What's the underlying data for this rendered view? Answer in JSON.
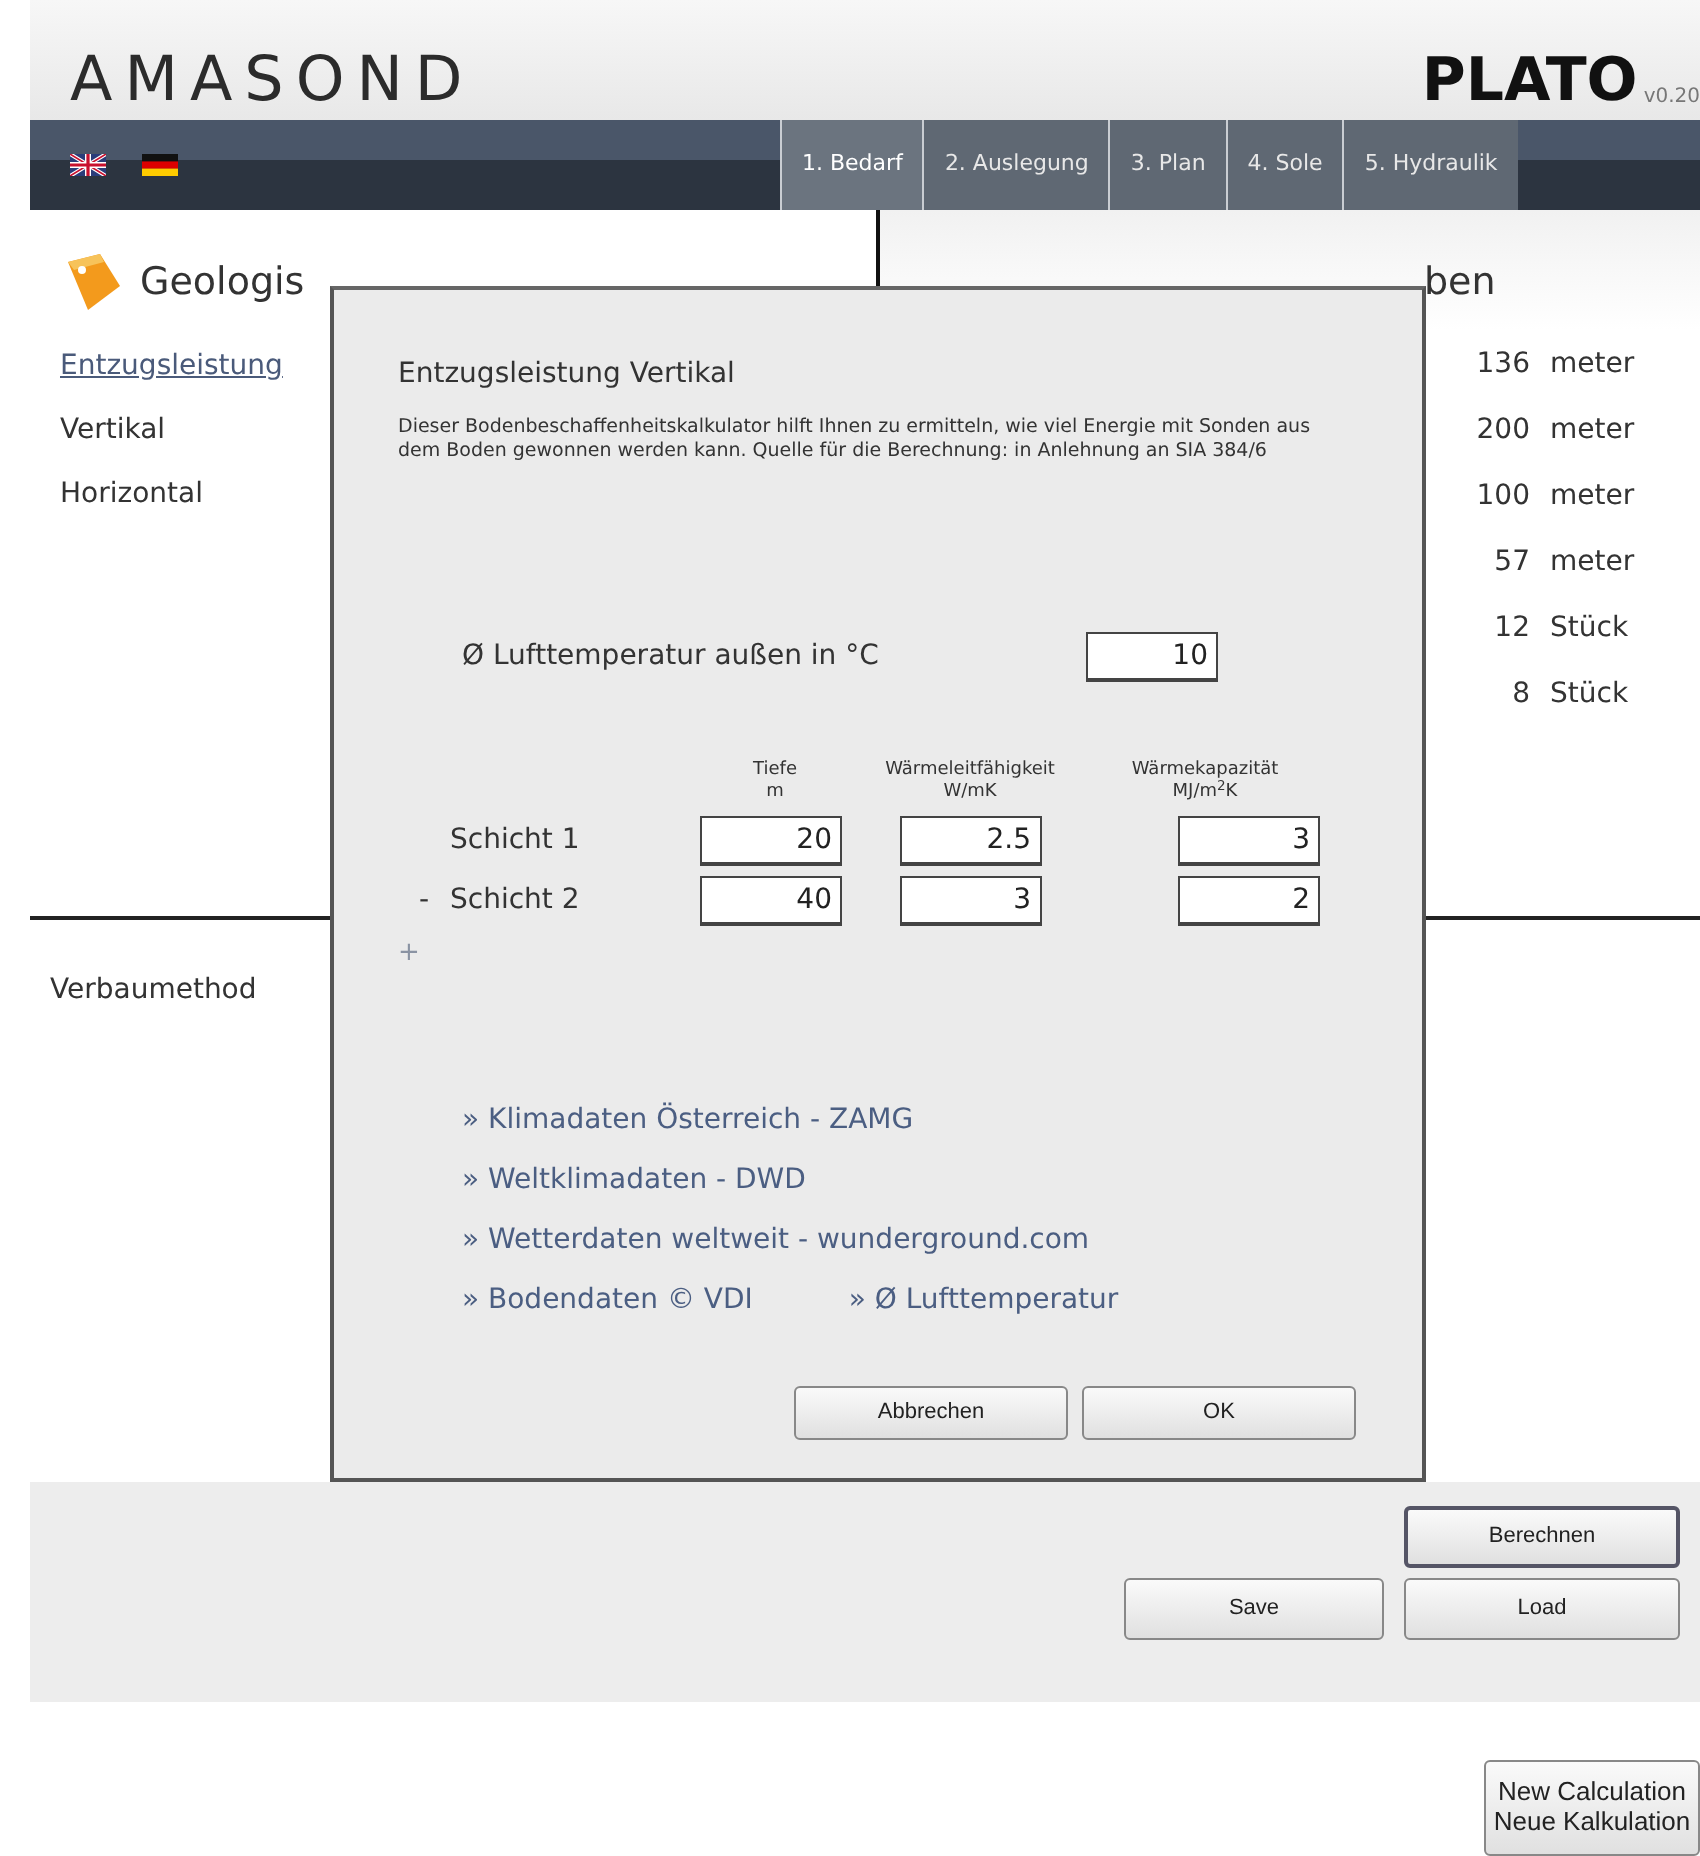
{
  "header": {
    "logo": "AMASOND",
    "product": "PLATO",
    "version": "v0.20"
  },
  "languages": [
    {
      "kind": "uk"
    },
    {
      "kind": "de"
    }
  ],
  "tabs": [
    {
      "label": "1. Bedarf",
      "selected": true
    },
    {
      "label": "2. Auslegung",
      "selected": false
    },
    {
      "label": "3. Plan",
      "selected": false
    },
    {
      "label": "4. Sole",
      "selected": false
    },
    {
      "label": "5. Hydraulik",
      "selected": false
    }
  ],
  "left_panel": {
    "title": "Geologis",
    "items": [
      {
        "label": "Entzugsleistung",
        "kind": "link"
      },
      {
        "label": "Vertikal",
        "kind": "text"
      },
      {
        "label": "Horizontal",
        "kind": "text"
      }
    ]
  },
  "right_panel": {
    "title": "ben",
    "rows": [
      {
        "value": "136",
        "unit": "meter"
      },
      {
        "value": "200",
        "unit": "meter"
      },
      {
        "value": "100",
        "unit": "meter"
      },
      {
        "value": "57",
        "unit": "meter"
      },
      {
        "value": "12",
        "unit": "Stück"
      },
      {
        "value": "8",
        "unit": "Stück"
      }
    ]
  },
  "lower_panel": {
    "title": "Verbaumethod"
  },
  "dialog": {
    "title": "Entzugsleistung Vertikal",
    "description": "Dieser Bodenbeschaffenheitskalkulator hilft Ihnen zu ermitteln, wie viel Energie mit Sonden aus dem Boden gewonnen werden kann. Quelle für die Berechnung: in Anlehnung an SIA 384/6",
    "temperature": {
      "label": "Ø Lufttemperatur außen in °C",
      "value": "10"
    },
    "columns": [
      {
        "label": "Tiefe",
        "unit": "m"
      },
      {
        "label": "Wärmeleitfähigkeit",
        "unit": "W/mK"
      },
      {
        "label": "Wärmekapazität",
        "unit": "MJ/m$^{2}$K"
      }
    ],
    "layers": [
      {
        "label": "Schicht 1",
        "values": [
          "20",
          "2.5",
          "3"
        ]
      },
      {
        "label": "Schicht 2",
        "remove": "-",
        "values": [
          "40",
          "3",
          "2"
        ]
      }
    ],
    "add": "+",
    "links": [
      [
        "» Klimadaten Österreich - ZAMG"
      ],
      [
        "» Weltklimadaten - DWD"
      ],
      [
        "» Wetterdaten weltweit - wunderground.com"
      ],
      [
        "» Bodendaten © VDI",
        "» Ø Lufttemperatur"
      ]
    ],
    "buttons": [
      "Abbrechen",
      "OK"
    ]
  },
  "actions": {
    "calculate": "Berechnen",
    "save": "Save",
    "load": "Load"
  },
  "new_calculation": [
    "New Calculation",
    "Neue Kalkulation"
  ]
}
